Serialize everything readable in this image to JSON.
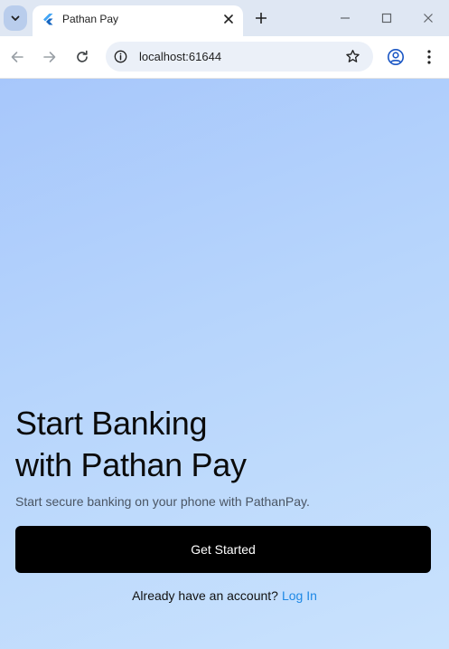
{
  "browser": {
    "tab": {
      "title": "Pathan Pay"
    },
    "address_bar": {
      "url": "localhost:61644"
    }
  },
  "page": {
    "headline_line1": "Start Banking",
    "headline_line2": "with Pathan Pay",
    "subtitle": "Start secure banking on your phone with PathanPay.",
    "cta_label": "Get Started",
    "login_prompt": "Already have an account?",
    "login_link": "Log In"
  },
  "colors": {
    "cta_background": "#000000",
    "link": "#1e88e5",
    "gradient_start": "#a7c7fb",
    "gradient_end": "#c9e2fd"
  }
}
